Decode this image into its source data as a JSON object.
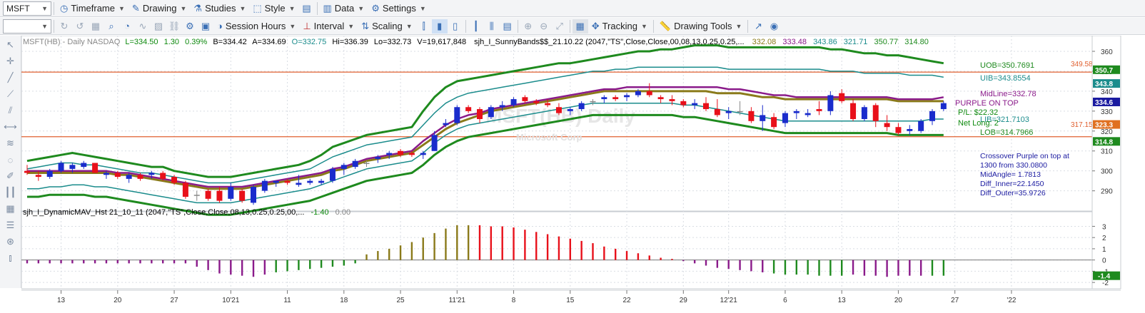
{
  "toolbar1": {
    "symbol": "MSFT",
    "timeframe": "Timeframe",
    "drawing": "Drawing",
    "studies": "Studies",
    "style": "Style",
    "data": "Data",
    "settings": "Settings"
  },
  "toolbar2": {
    "session_hours": "Session Hours",
    "interval": "Interval",
    "scaling": "Scaling",
    "tracking": "Tracking",
    "drawing_tools": "Drawing Tools"
  },
  "price_header": {
    "symbol": "MSFT(HB) - Daily  NASDAQ",
    "last": "L=334.50",
    "change": "1.30",
    "pct": "0.39%",
    "bid": "B=334.42",
    "ask": "A=334.69",
    "open": "O=332.75",
    "high": "Hi=336.39",
    "low": "Lo=332.73",
    "volume": "V=19,617,848",
    "study": "sjh_I_SunnyBands$$_21.10.22 (2047,\"TS\",Close,Close,00,08,13,0.25,0.25,...",
    "values": [
      "332.08",
      "333.48",
      "343.86",
      "321.71",
      "350.77",
      "314.80"
    ]
  },
  "sub_header": {
    "study": "sjh_I_DynamicMAV_Hst 21_10_11 (2047,\"TS\",Close,Close,08,13,0.25,0.25,00,...",
    "v1": "-1.40",
    "v2": "0.00"
  },
  "watermark": {
    "title": "MSFT(HB) Daily",
    "sub": "Microsoft Corp"
  },
  "annotations": {
    "uob": "UOB=350.7691",
    "uib": "UIB=343.8554",
    "midline": "MidLine=332.78",
    "purple": "PURPLE ON TOP",
    "pl": "P/L: $22.32",
    "lib": "LIB=321.7103",
    "netlong": "Net Long: 2",
    "lob": "LOB=314.7966",
    "line_hi": "349.58",
    "line_lo": "317.15",
    "info": [
      "Crossover Purple on top at",
      "1300 from 330.0800",
      "MidAngle= 1.7813",
      "Diff_Inner=22.1450",
      "Diff_Outer=35.9726"
    ]
  },
  "price_axis": {
    "ticks": [
      "360",
      "350",
      "340",
      "330",
      "320",
      "310",
      "300",
      "290"
    ],
    "badges": [
      "350.7",
      "343.8",
      "334.6",
      "323.3",
      "314.8"
    ]
  },
  "sub_axis": {
    "ticks": [
      "3",
      "2",
      "1",
      "0",
      "-1",
      "-2"
    ],
    "badge": "-1.4"
  },
  "date_axis": [
    "13",
    "20",
    "27",
    "10'21",
    "11",
    "18",
    "25",
    "11'21",
    "8",
    "15",
    "22",
    "29",
    "12'21",
    "6",
    "13",
    "20",
    "27",
    "'22"
  ],
  "chart_data": {
    "type": "candlestick",
    "y_range": [
      282,
      365
    ],
    "candles": [
      [
        300,
        303,
        298,
        299
      ],
      [
        298,
        300,
        295,
        297
      ],
      [
        297,
        301,
        296,
        300
      ],
      [
        300,
        305,
        299,
        304
      ],
      [
        301,
        304,
        299,
        303
      ],
      [
        302,
        305,
        301,
        304
      ],
      [
        304,
        304,
        299,
        299
      ],
      [
        298,
        300,
        296,
        299
      ],
      [
        299,
        300,
        296,
        297
      ],
      [
        296,
        299,
        294,
        298
      ],
      [
        298,
        299,
        295,
        296
      ],
      [
        298,
        300,
        296,
        299
      ],
      [
        299,
        300,
        295,
        296
      ],
      [
        297,
        298,
        293,
        294
      ],
      [
        294,
        295,
        286,
        287
      ],
      [
        288,
        290,
        285,
        288
      ],
      [
        290,
        291,
        285,
        286
      ],
      [
        290,
        292,
        284,
        285
      ],
      [
        286,
        294,
        285,
        292
      ],
      [
        290,
        291,
        284,
        285
      ],
      [
        284,
        293,
        283,
        292
      ],
      [
        290,
        296,
        289,
        295
      ],
      [
        294,
        295,
        292,
        295
      ],
      [
        295,
        296,
        293,
        294
      ],
      [
        293,
        298,
        292,
        294
      ],
      [
        294,
        296,
        293,
        295
      ],
      [
        294,
        296,
        293,
        295
      ],
      [
        295,
        302,
        294,
        301
      ],
      [
        301,
        304,
        298,
        303
      ],
      [
        302,
        306,
        301,
        305
      ],
      [
        304,
        305,
        302,
        304
      ],
      [
        306,
        308,
        304,
        307
      ],
      [
        308,
        310,
        306,
        309
      ],
      [
        310,
        311,
        307,
        308
      ],
      [
        309,
        310,
        307,
        308
      ],
      [
        308,
        310,
        306,
        309
      ],
      [
        310,
        320,
        310,
        318
      ],
      [
        323,
        326,
        322,
        324
      ],
      [
        324,
        333,
        323,
        332
      ],
      [
        332,
        333,
        329,
        330
      ],
      [
        331,
        332,
        324,
        326
      ],
      [
        327,
        333,
        326,
        332
      ],
      [
        332,
        335,
        330,
        333
      ],
      [
        333,
        337,
        332,
        336
      ],
      [
        337,
        338,
        334,
        335
      ],
      [
        335,
        336,
        333,
        334
      ],
      [
        334,
        336,
        332,
        333
      ],
      [
        332,
        334,
        328,
        329
      ],
      [
        330,
        332,
        328,
        331
      ],
      [
        331,
        335,
        330,
        334
      ],
      [
        335,
        336,
        333,
        335
      ],
      [
        336,
        338,
        334,
        337
      ],
      [
        337,
        338,
        335,
        336
      ],
      [
        337,
        339,
        335,
        338
      ],
      [
        338,
        341,
        337,
        340
      ],
      [
        340,
        344,
        337,
        338
      ],
      [
        337,
        338,
        334,
        336
      ],
      [
        336,
        338,
        333,
        335
      ],
      [
        335,
        336,
        332,
        333
      ],
      [
        333,
        336,
        331,
        334
      ],
      [
        334,
        337,
        330,
        331
      ],
      [
        331,
        336,
        327,
        328
      ],
      [
        329,
        332,
        326,
        330
      ],
      [
        330,
        335,
        328,
        330
      ],
      [
        330,
        332,
        324,
        325
      ],
      [
        325,
        333,
        320,
        328
      ],
      [
        327,
        329,
        321,
        322
      ],
      [
        324,
        330,
        322,
        329
      ],
      [
        329,
        331,
        326,
        330
      ],
      [
        328,
        331,
        327,
        329
      ],
      [
        331,
        335,
        328,
        330
      ],
      [
        330,
        340,
        328,
        338
      ],
      [
        339,
        341,
        334,
        335
      ],
      [
        334,
        336,
        325,
        326
      ],
      [
        326,
        333,
        325,
        332
      ],
      [
        333,
        334,
        322,
        325
      ],
      [
        324,
        328,
        320,
        322
      ],
      [
        322,
        324,
        318,
        319
      ],
      [
        320,
        323,
        318,
        321
      ],
      [
        320,
        326,
        319,
        325
      ],
      [
        325,
        331,
        323,
        330
      ],
      [
        331,
        335,
        330,
        334
      ]
    ],
    "outer_upper": [
      305,
      306,
      307,
      308,
      309,
      308,
      307,
      306,
      305,
      304,
      303,
      302,
      302,
      300,
      299,
      298,
      297,
      297,
      297,
      298,
      299,
      300,
      301,
      302,
      303,
      305,
      308,
      312,
      314,
      316,
      318,
      319,
      320,
      321,
      322,
      330,
      337,
      342,
      345,
      346,
      347,
      348,
      349,
      350,
      351,
      352,
      353,
      354,
      354,
      355,
      356,
      357,
      358,
      359,
      360,
      360,
      361,
      361,
      362,
      363,
      363,
      363,
      362,
      362,
      362,
      362,
      362,
      362,
      362,
      362,
      362,
      361,
      361,
      360,
      359,
      359,
      358,
      358,
      357,
      356,
      355,
      354
    ],
    "inner_upper": [
      301,
      302,
      303,
      304,
      304,
      303,
      303,
      302,
      301,
      300,
      299,
      299,
      298,
      297,
      296,
      295,
      294,
      294,
      294,
      295,
      296,
      297,
      298,
      299,
      300,
      301,
      304,
      307,
      309,
      311,
      313,
      314,
      315,
      316,
      317,
      323,
      329,
      334,
      337,
      339,
      340,
      341,
      342,
      343,
      344,
      345,
      346,
      347,
      348,
      349,
      350,
      350,
      351,
      351,
      352,
      352,
      352,
      352,
      352,
      352,
      352,
      352,
      351,
      351,
      351,
      351,
      351,
      351,
      351,
      351,
      351,
      350,
      350,
      350,
      349,
      349,
      349,
      349,
      348,
      348,
      348,
      347
    ],
    "inner_lower": [
      291,
      291,
      292,
      292,
      293,
      293,
      292,
      292,
      291,
      290,
      289,
      288,
      287,
      286,
      285,
      284,
      284,
      284,
      284,
      285,
      286,
      287,
      288,
      289,
      290,
      291,
      293,
      295,
      297,
      299,
      301,
      302,
      303,
      304,
      305,
      309,
      314,
      318,
      321,
      323,
      324,
      325,
      326,
      327,
      328,
      329,
      330,
      331,
      332,
      333,
      334,
      334,
      334,
      334,
      334,
      334,
      334,
      334,
      333,
      333,
      332,
      331,
      330,
      329,
      328,
      327,
      326,
      325,
      325,
      325,
      325,
      325,
      325,
      325,
      325,
      325,
      325,
      325,
      325,
      325,
      326,
      326
    ],
    "outer_lower": [
      287,
      287,
      288,
      288,
      288,
      288,
      287,
      287,
      286,
      285,
      284,
      283,
      282,
      281,
      280,
      279,
      278,
      278,
      278,
      279,
      280,
      281,
      282,
      283,
      284,
      285,
      287,
      289,
      291,
      293,
      295,
      296,
      297,
      298,
      299,
      303,
      308,
      312,
      315,
      317,
      318,
      319,
      320,
      321,
      322,
      323,
      324,
      325,
      326,
      327,
      328,
      328,
      328,
      328,
      328,
      328,
      328,
      328,
      327,
      327,
      326,
      325,
      324,
      323,
      322,
      321,
      320,
      319,
      319,
      319,
      319,
      319,
      319,
      319,
      319,
      319,
      319,
      318,
      318,
      318,
      318,
      318
    ],
    "purple_ma": [
      300,
      300,
      300,
      300,
      300,
      300,
      300,
      300,
      299,
      299,
      298,
      297,
      296,
      295,
      294,
      293,
      292,
      292,
      292,
      292,
      293,
      294,
      295,
      296,
      297,
      298,
      299,
      301,
      302,
      304,
      306,
      307,
      308,
      309,
      310,
      315,
      319,
      323,
      326,
      328,
      329,
      331,
      332,
      333,
      334,
      335,
      336,
      337,
      338,
      339,
      340,
      341,
      341,
      342,
      342,
      342,
      342,
      342,
      342,
      342,
      342,
      342,
      341,
      341,
      340,
      339,
      338,
      338,
      337,
      337,
      337,
      337,
      337,
      337,
      337,
      337,
      337,
      336,
      336,
      336,
      336,
      337
    ],
    "olive_ma": [
      299,
      299,
      299,
      299,
      299,
      299,
      299,
      299,
      298,
      298,
      297,
      296,
      295,
      294,
      293,
      292,
      291,
      291,
      291,
      291,
      292,
      293,
      294,
      295,
      296,
      297,
      298,
      300,
      301,
      303,
      305,
      306,
      307,
      308,
      309,
      313,
      317,
      321,
      324,
      326,
      328,
      330,
      331,
      332,
      333,
      334,
      335,
      336,
      337,
      338,
      339,
      340,
      340,
      340,
      340,
      340,
      340,
      340,
      340,
      340,
      340,
      339,
      339,
      339,
      338,
      337,
      337,
      336,
      336,
      336,
      336,
      336,
      336,
      336,
      336,
      336,
      336,
      335,
      335,
      335,
      335,
      335
    ],
    "histogram": [
      -0.3,
      -0.3,
      -0.3,
      -0.3,
      -0.3,
      -0.3,
      -0.3,
      -0.3,
      -0.3,
      -0.3,
      -0.3,
      -0.3,
      -0.3,
      -0.3,
      -0.3,
      -0.6,
      -0.9,
      -1.2,
      -1.3,
      -1.4,
      -1.5,
      -1.3,
      -1.1,
      -1.0,
      -0.9,
      -0.8,
      -0.7,
      -0.6,
      -0.5,
      -0.3,
      0.5,
      0.8,
      1.0,
      1.3,
      1.6,
      2.0,
      2.4,
      2.8,
      3.1,
      3.1,
      3.1,
      3.0,
      3.0,
      2.9,
      2.7,
      2.5,
      2.3,
      2.1,
      1.9,
      1.7,
      1.5,
      1.2,
      1.0,
      0.8,
      0.6,
      0.4,
      0.2,
      0.1,
      -0.1,
      -0.3,
      -0.5,
      -0.7,
      -0.8,
      -0.9,
      -1.0,
      -1.1,
      -1.2,
      -1.3,
      -1.3,
      -1.3,
      -1.4,
      -1.4,
      -1.4,
      -1.3,
      -1.4,
      -1.4,
      -1.5,
      -1.4,
      -1.4,
      -1.4,
      -1.4,
      -1.4
    ],
    "hist_range": [
      -2.5,
      3.6
    ],
    "h_lines": [
      349.58,
      317.15
    ]
  },
  "colors": {
    "up": "#1a2ccc",
    "down": "#e8101a",
    "doji": "#888888",
    "outer": "#1e8a1e",
    "inner": "#1b8c8c",
    "purple": "#8a1a8a",
    "olive": "#8a7a1a",
    "hline": "#e06030",
    "hist_neg": "#8a1a8a",
    "hist_pos": "#e8101a",
    "hist_zero": "#777777"
  }
}
